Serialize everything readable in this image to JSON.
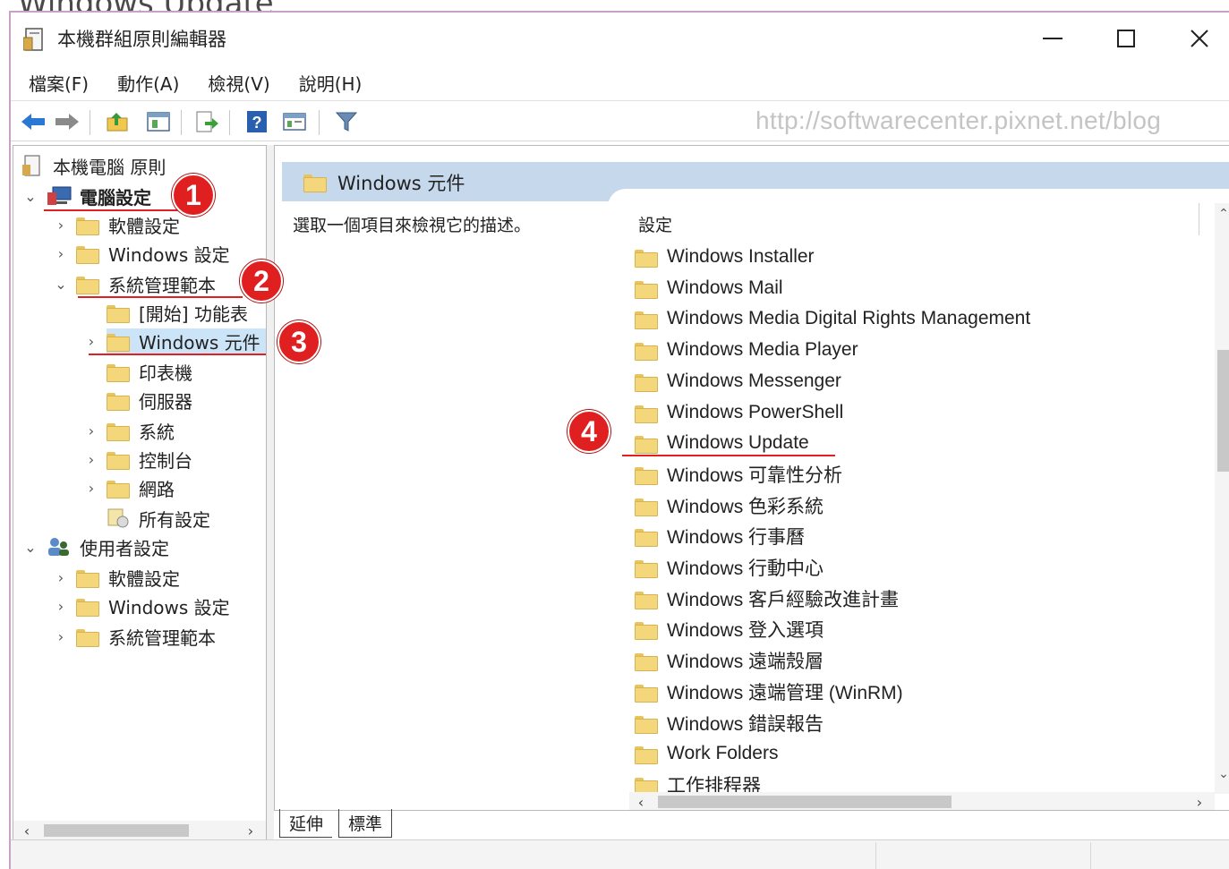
{
  "window": {
    "title": "本機群組原則編輯器"
  },
  "top_clip_text": "Windows Update",
  "menu": [
    {
      "label": "檔案(F)"
    },
    {
      "label": "動作(A)"
    },
    {
      "label": "檢視(V)"
    },
    {
      "label": "說明(H)"
    }
  ],
  "toolbar": {
    "watermark": "http://softwarecenter.pixnet.net/blog",
    "icons": [
      "back-arrow-icon",
      "forward-arrow-icon",
      "up-folder-icon",
      "show-hide-tree-icon",
      "export-list-icon",
      "help-icon",
      "properties-icon",
      "filter-icon"
    ]
  },
  "tree": {
    "root": "本機電腦 原則",
    "computer_config": "電腦設定",
    "software_settings": "軟體設定",
    "windows_settings": "Windows 設定",
    "admin_templates": "系統管理範本",
    "start_menu": "[開始] 功能表",
    "windows_components": "Windows 元件",
    "printers": "印表機",
    "server": "伺服器",
    "system": "系統",
    "control_panel": "控制台",
    "network": "網路",
    "all_settings": "所有設定",
    "user_config": "使用者設定",
    "user_software_settings": "軟體設定",
    "user_windows_settings": "Windows 設定",
    "user_admin_templates": "系統管理範本"
  },
  "badges": [
    "1",
    "2",
    "3",
    "4"
  ],
  "details": {
    "header_title": "Windows 元件",
    "description_hint": "選取一個項目來檢視它的描述。",
    "column_header": "設定",
    "items": [
      "Windows Installer",
      "Windows Mail",
      "Windows Media Digital Rights Management",
      "Windows Media Player",
      "Windows Messenger",
      "Windows PowerShell",
      "Windows Update",
      "Windows 可靠性分析",
      "Windows 色彩系統",
      "Windows 行事曆",
      "Windows 行動中心",
      "Windows 客戶經驗改進計畫",
      "Windows 登入選項",
      "Windows 遠端殼層",
      "Windows 遠端管理 (WinRM)",
      "Windows 錯誤報告",
      "Work Folders",
      "工作排程器"
    ]
  },
  "tabs": {
    "extended": "延伸",
    "standard": "標準"
  },
  "colors": {
    "accent_red": "#e02020",
    "header_blue": "#c6d9ec",
    "folder_yellow": "#f4d77a"
  }
}
